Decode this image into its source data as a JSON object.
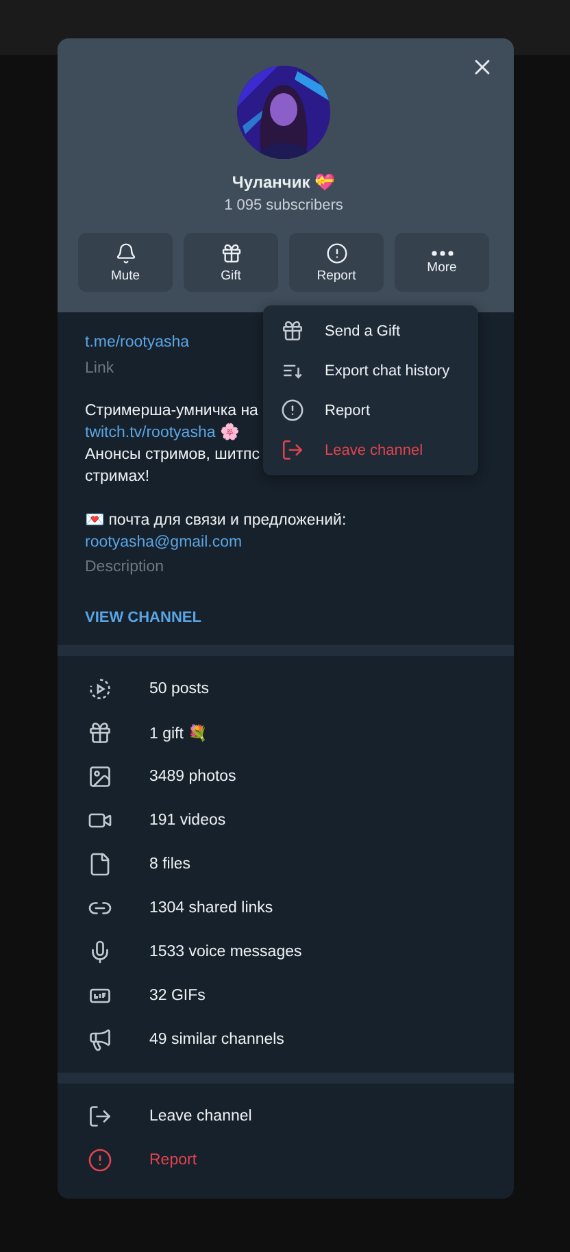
{
  "header": {
    "title": "Чуланчик 💝",
    "subscribers": "1 095 subscribers",
    "actions": [
      {
        "label": "Mute",
        "kind": "bell"
      },
      {
        "label": "Gift",
        "kind": "gift"
      },
      {
        "label": "Report",
        "kind": "alert"
      },
      {
        "label": "More",
        "kind": "more"
      }
    ]
  },
  "menu": [
    {
      "label": "Send a Gift",
      "kind": "gift",
      "danger": false
    },
    {
      "label": "Export chat history",
      "kind": "export",
      "danger": false
    },
    {
      "label": "Report",
      "kind": "alert",
      "danger": false
    },
    {
      "label": "Leave channel",
      "kind": "leave",
      "danger": true
    }
  ],
  "info": {
    "link": "t.me/rootyasha",
    "link_label": "Link",
    "description_lines": [
      {
        "text": "Стримерша-умничка на",
        "kind": "text"
      },
      {
        "text": "twitch.tv/rootyasha",
        "kind": "link",
        "emoji": "🌸"
      },
      {
        "text": "Анонсы стримов, шитпс",
        "kind": "text"
      },
      {
        "text": "стримах!",
        "kind": "text"
      },
      {
        "text": "💌 почта для связи и предложений:",
        "kind": "gap"
      },
      {
        "text": "rootyasha@gmail.com",
        "kind": "link"
      }
    ],
    "description_label": "Description",
    "view_button": "VIEW CHANNEL"
  },
  "stats": [
    {
      "label": "50 posts",
      "kind": "posts"
    },
    {
      "label": "1 gift 💐",
      "kind": "gift"
    },
    {
      "label": "3489 photos"
    },
    {
      "label": "191 videos",
      "kind": "video"
    },
    {
      "label": "8 files",
      "kind": "file"
    },
    {
      "label": "1304 shared links",
      "kind": "link"
    },
    {
      "label": "1533 voice messages",
      "kind": "mic"
    },
    {
      "label": "32 GIFs",
      "kind": "gif"
    },
    {
      "label": "49 similar channels",
      "kind": "megaphone"
    }
  ],
  "bottom": [
    {
      "label": "Leave channel",
      "kind": "leave",
      "danger": false
    },
    {
      "label": "Report",
      "kind": "alert",
      "danger": true
    }
  ]
}
